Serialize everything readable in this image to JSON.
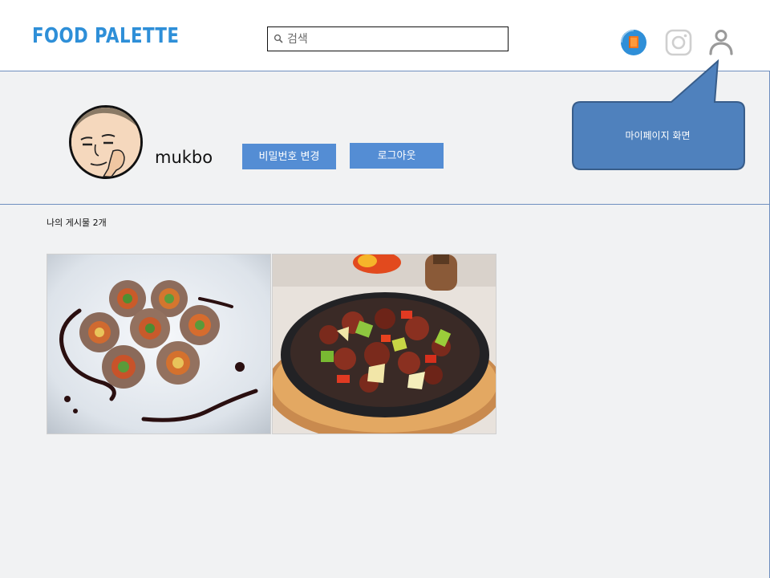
{
  "header": {
    "logo_text": "FOOD PALETTE",
    "search_placeholder": "검색",
    "icons": [
      "feed-icon",
      "instagram-icon",
      "user-icon"
    ]
  },
  "profile": {
    "username": "mukbo",
    "change_password_label": "비밀번호 변경",
    "logout_label": "로그아웃"
  },
  "annotation": {
    "callout_text": "마이페이지 화면"
  },
  "posts": {
    "count_label": "나의 게시물 2개",
    "items": [
      {
        "alt": "beef vegetable rolls"
      },
      {
        "alt": "sizzling beef with peppers"
      }
    ]
  },
  "colors": {
    "brand": "#2e8fd8",
    "button": "#548dd4",
    "callout": "#4f81bd",
    "background": "#f1f2f3",
    "divider": "#6f8fbf"
  }
}
